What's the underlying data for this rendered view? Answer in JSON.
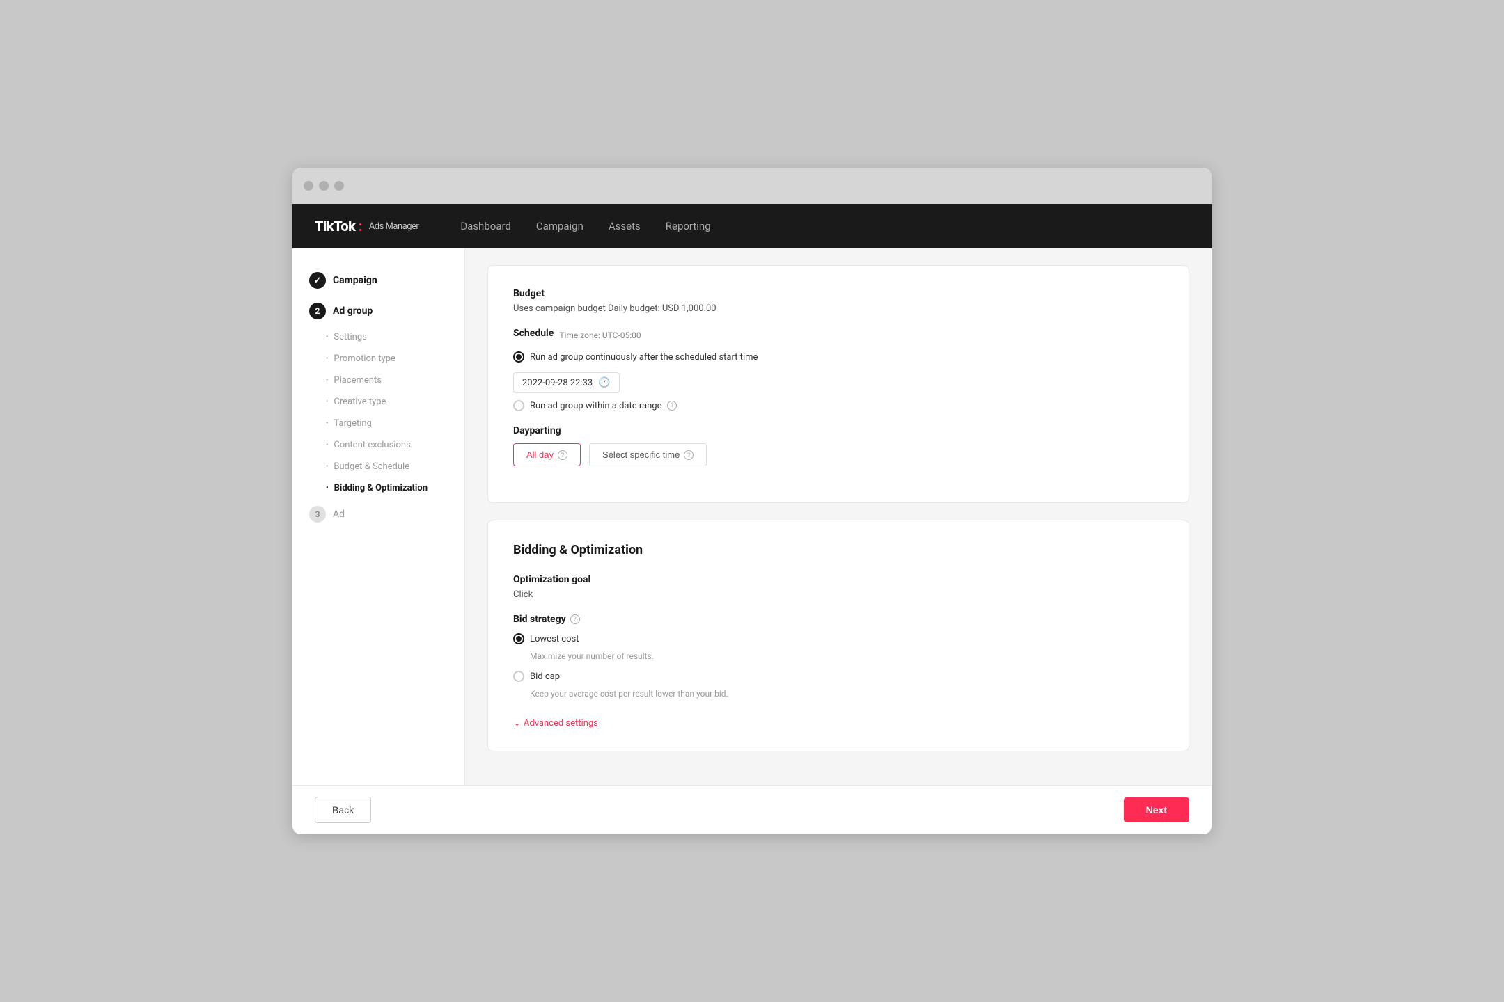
{
  "browser": {
    "traffic_lights": [
      "",
      "",
      ""
    ]
  },
  "nav": {
    "logo_brand": "TikTok",
    "logo_colon": ":",
    "logo_product": "Ads Manager",
    "links": [
      {
        "label": "Dashboard",
        "key": "dashboard"
      },
      {
        "label": "Campaign",
        "key": "campaign"
      },
      {
        "label": "Assets",
        "key": "assets"
      },
      {
        "label": "Reporting",
        "key": "reporting"
      }
    ]
  },
  "sidebar": {
    "step1": {
      "badge": "✓",
      "label": "Campaign",
      "state": "done"
    },
    "step2": {
      "badge": "2",
      "label": "Ad group",
      "state": "current",
      "sub_items": [
        {
          "label": "Settings",
          "active": false
        },
        {
          "label": "Promotion type",
          "active": false
        },
        {
          "label": "Placements",
          "active": false
        },
        {
          "label": "Creative type",
          "active": false
        },
        {
          "label": "Targeting",
          "active": false
        },
        {
          "label": "Content exclusions",
          "active": false
        },
        {
          "label": "Budget & Schedule",
          "active": false
        },
        {
          "label": "Bidding & Optimization",
          "active": true
        }
      ]
    },
    "step3": {
      "badge": "3",
      "label": "Ad",
      "state": "pending"
    }
  },
  "budget_section": {
    "label": "Budget",
    "value": "Uses campaign budget Daily budget: USD 1,000.00"
  },
  "schedule_section": {
    "label": "Schedule",
    "timezone_label": "Time zone: UTC-05:00",
    "option1_label": "Run ad group continuously after the scheduled start time",
    "date_value": "2022-09-28 22:33",
    "option2_label": "Run ad group within a date range"
  },
  "dayparting_section": {
    "label": "Dayparting",
    "btn_all_day": "All day",
    "btn_specific": "Select specific time"
  },
  "bidding_section": {
    "title": "Bidding & Optimization",
    "opt_goal_label": "Optimization goal",
    "opt_goal_value": "Click",
    "bid_strategy_label": "Bid strategy",
    "option_lowest_cost": "Lowest cost",
    "option_lowest_cost_sub": "Maximize your number of results.",
    "option_bid_cap": "Bid cap",
    "option_bid_cap_sub": "Keep your average cost per result lower than your bid.",
    "advanced_link": "Advanced settings"
  },
  "footer": {
    "back_label": "Back",
    "next_label": "Next"
  }
}
